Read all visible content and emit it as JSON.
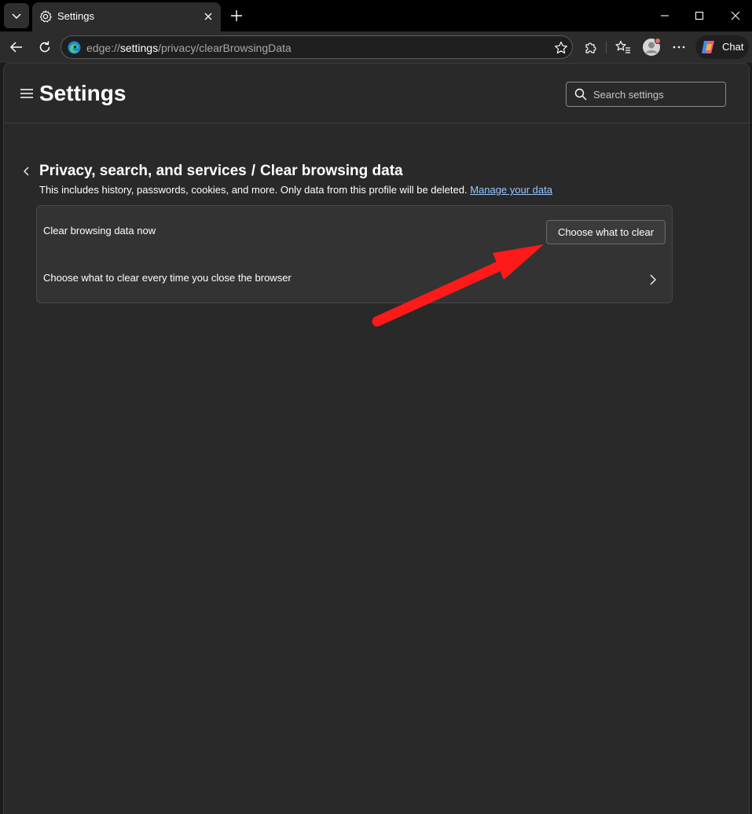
{
  "tab": {
    "title": "Settings"
  },
  "address": {
    "scheme": "edge://",
    "host": "settings",
    "path": "/privacy/clearBrowsingData"
  },
  "toolbar": {
    "chat_label": "Chat"
  },
  "header": {
    "title": "Settings",
    "search_placeholder": "Search settings"
  },
  "breadcrumb": {
    "parent": "Privacy, search, and services",
    "separator": "/",
    "current": "Clear browsing data"
  },
  "description": {
    "text": "This includes history, passwords, cookies, and more. Only data from this profile will be deleted.",
    "link": "Manage your data"
  },
  "card": {
    "row1_label": "Clear browsing data now",
    "row1_button": "Choose what to clear",
    "row2_label": "Choose what to clear every time you close the browser"
  },
  "colors": {
    "accent_link": "#99c6ff",
    "annotation_arrow": "#ff1a1a",
    "surface": "#292929"
  },
  "icons": [
    "tab-list-icon",
    "gear-icon",
    "close-icon",
    "plus-icon",
    "minimize-icon",
    "maximize-icon",
    "back-icon",
    "refresh-icon",
    "edge-logo-icon",
    "star-icon",
    "extensions-icon",
    "favorites-icon",
    "avatar-icon",
    "more-icon",
    "copilot-icon",
    "hamburger-icon",
    "search-icon",
    "chevron-left-icon",
    "chevron-right-icon"
  ]
}
